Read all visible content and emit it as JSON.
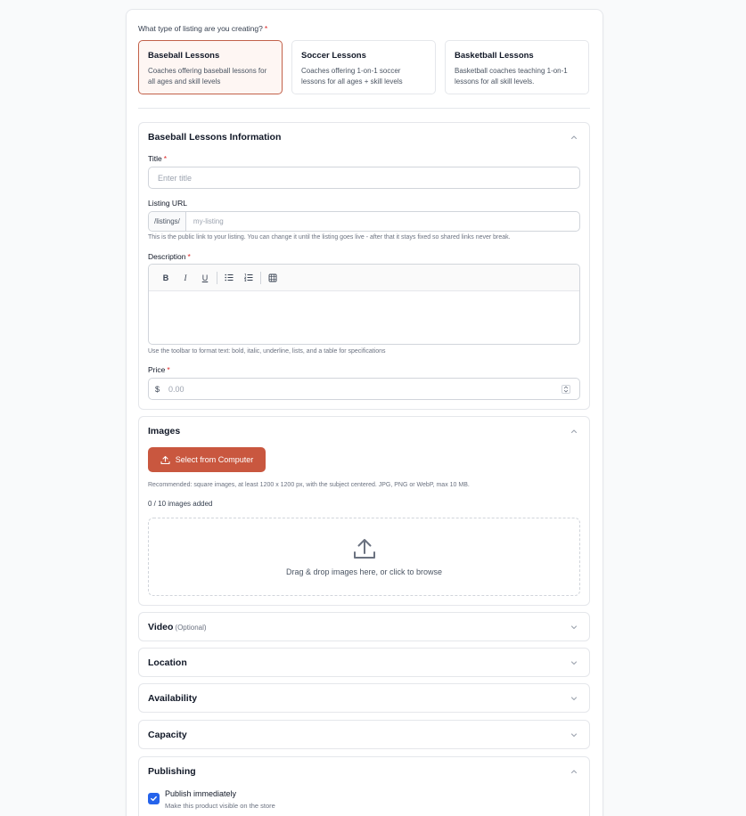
{
  "form": {
    "listing_type_question": "What type of listing are you creating?",
    "required_mark": "*",
    "listing_types": [
      {
        "title": "Baseball Lessons",
        "description": "Coaches offering baseball lessons for all ages and skill levels",
        "selected": true
      },
      {
        "title": "Soccer Lessons",
        "description": "Coaches offering 1-on-1 soccer lessons for all ages + skill levels",
        "selected": false
      },
      {
        "title": "Basketball Lessons",
        "description": "Basketball coaches teaching 1-on-1 lessons for all skill levels.",
        "selected": false
      }
    ]
  },
  "info_section": {
    "title": "Baseball Lessons Information",
    "title_label": "Title",
    "title_placeholder": "Enter title",
    "url_label": "Listing URL",
    "url_prefix": "/listings/",
    "url_placeholder": "my-listing",
    "url_helper": "This is the public link to your listing. You can change it until the listing goes live - after that it stays fixed so shared links never break.",
    "description_label": "Description",
    "toolbar": {
      "bold": "B",
      "italic": "I",
      "underline": "U"
    },
    "description_helper": "Use the toolbar to format text: bold, italic, underline, lists, and a table for specifications",
    "price_label": "Price",
    "currency_symbol": "$",
    "price_placeholder": "0.00"
  },
  "images_section": {
    "title": "Images",
    "select_button": "Select from Computer",
    "recommendation": "Recommended: square images, at least 1200 x 1200 px, with the subject centered. JPG, PNG or WebP, max 10 MB.",
    "count_text": "0 / 10 images added",
    "dropzone_text": "Drag & drop images here, or click to browse"
  },
  "collapsed_sections": {
    "video": {
      "title": "Video",
      "optional": "(Optional)"
    },
    "location": {
      "title": "Location"
    },
    "availability": {
      "title": "Availability"
    },
    "capacity": {
      "title": "Capacity"
    }
  },
  "publishing_section": {
    "title": "Publishing",
    "publish_label": "Publish immediately",
    "publish_desc": "Make this product visible on the store",
    "publish_checked": true
  },
  "colors": {
    "accent": "#c9573f",
    "selected_bg": "#fef6f3",
    "checkbox": "#2563eb",
    "required": "#dc2626"
  }
}
